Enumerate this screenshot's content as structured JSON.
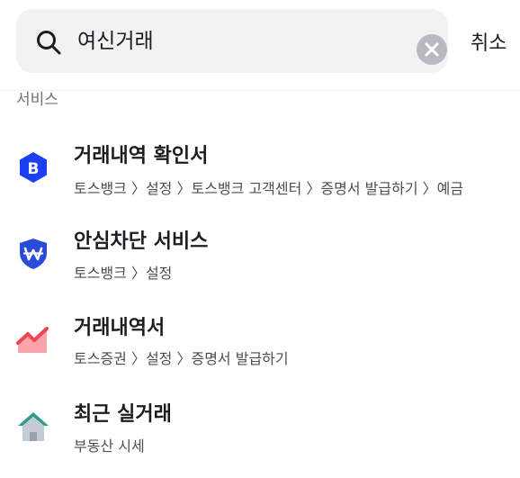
{
  "search": {
    "value": "여신거래",
    "cancel_label": "취소"
  },
  "section": {
    "label": "서비스"
  },
  "results": [
    {
      "title": "거래내역 확인서",
      "path": "토스뱅크 〉설정 〉토스뱅크 고객센터 〉증명서 발급하기 〉예금",
      "icon": "toss-bank-b-icon",
      "icon_color": "#1b3ff5"
    },
    {
      "title": "안심차단 서비스",
      "path": "토스뱅크 〉설정",
      "icon": "won-shield-icon",
      "icon_color": "#2a4bd7"
    },
    {
      "title": "거래내역서",
      "path": "토스증권 〉설정 〉증명서 발급하기",
      "icon": "stock-chart-icon",
      "icon_color": "#f04452"
    },
    {
      "title": "최근 실거래",
      "path": "부동산 시세",
      "icon": "house-icon",
      "icon_color": "#2a9d8f"
    }
  ]
}
